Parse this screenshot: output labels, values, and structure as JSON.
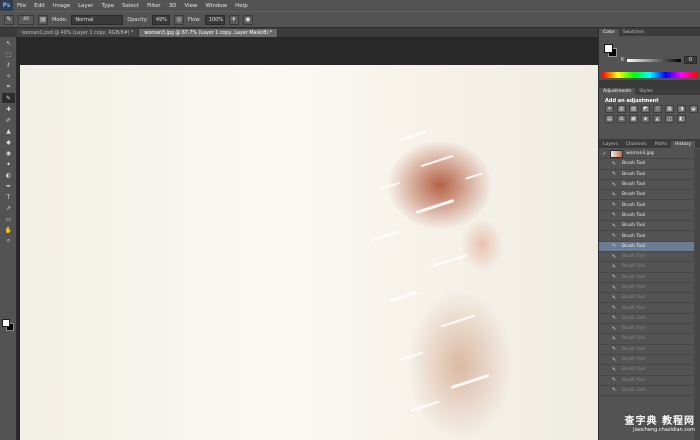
{
  "menubar": {
    "logo": "Ps",
    "items": [
      "File",
      "Edit",
      "Image",
      "Layer",
      "Type",
      "Select",
      "Filter",
      "3D",
      "View",
      "Window",
      "Help"
    ]
  },
  "options_bar": {
    "brush_size": "40",
    "mode_label": "Mode:",
    "mode_value": "Normal",
    "opacity_label": "Opacity:",
    "opacity_value": "49%",
    "flow_label": "Flow:",
    "flow_value": "100%"
  },
  "doc_tabs": [
    {
      "label": "woman1.psd @ 49% (Layer 1 copy, RGB/8#) *",
      "active": false
    },
    {
      "label": "woman3.jpg @ 67.7% (Layer 1 copy, Layer Mask/8) *",
      "active": true
    }
  ],
  "tools": [
    "↖",
    "⬚",
    "ℓ",
    "✧",
    "⌗",
    "✎",
    "✚",
    "✐",
    "▲",
    "◆",
    "◉",
    "✦",
    "◐",
    "✒",
    "T",
    "↗",
    "▭",
    "✋",
    "⌕"
  ],
  "color_panel": {
    "tabs": [
      "Color",
      "Swatches"
    ],
    "channel_label": "K",
    "channel_value": "0"
  },
  "adjustments_panel": {
    "tabs": [
      "Adjustments",
      "Styles"
    ],
    "title": "Add an adjustment",
    "icons": [
      "☀",
      "▥",
      "▨",
      "◩",
      "▽",
      "▦",
      "◑",
      "◒",
      "▤",
      "⚖",
      "▣",
      "◈",
      "◭",
      "◫",
      "◧"
    ]
  },
  "history_panel": {
    "tabs": [
      "Layers",
      "Channels",
      "Paths",
      "History"
    ],
    "snapshot": "woman3.jpg",
    "items": [
      {
        "label": "Brush Tool",
        "state": "normal"
      },
      {
        "label": "Brush Tool",
        "state": "normal"
      },
      {
        "label": "Brush Tool",
        "state": "normal"
      },
      {
        "label": "Brush Tool",
        "state": "normal"
      },
      {
        "label": "Brush Tool",
        "state": "normal"
      },
      {
        "label": "Brush Tool",
        "state": "normal"
      },
      {
        "label": "Brush Tool",
        "state": "normal"
      },
      {
        "label": "Brush Tool",
        "state": "normal"
      },
      {
        "label": "Brush Tool",
        "state": "current"
      },
      {
        "label": "Brush Tool",
        "state": "dim"
      },
      {
        "label": "Brush Tool",
        "state": "dim"
      },
      {
        "label": "Brush Tool",
        "state": "dim"
      },
      {
        "label": "Brush Tool",
        "state": "dim"
      },
      {
        "label": "Brush Tool",
        "state": "dim"
      },
      {
        "label": "Brush Tool",
        "state": "dim"
      },
      {
        "label": "Brush Tool",
        "state": "dim"
      },
      {
        "label": "Brush Tool",
        "state": "dim"
      },
      {
        "label": "Brush Tool",
        "state": "dim"
      },
      {
        "label": "Brush Tool",
        "state": "dim"
      },
      {
        "label": "Brush Tool",
        "state": "dim"
      },
      {
        "label": "Brush Tool",
        "state": "dim"
      },
      {
        "label": "Brush Tool",
        "state": "dim"
      },
      {
        "label": "Brush Tool",
        "state": "dim"
      }
    ]
  },
  "watermark": {
    "title": "查字典 教程网",
    "url": "jiaocheng.chazidian.com"
  }
}
